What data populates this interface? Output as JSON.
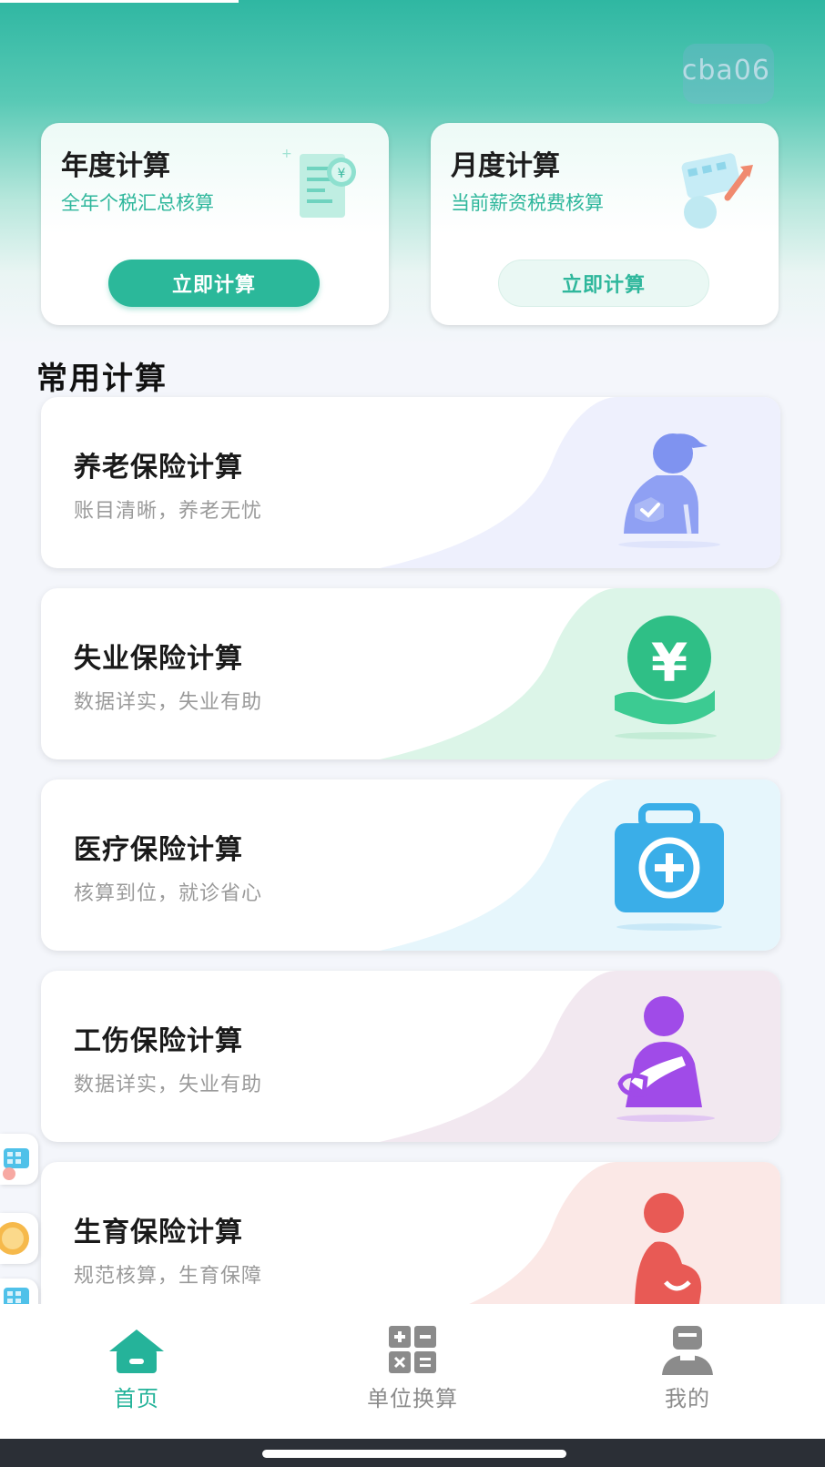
{
  "watermark": {
    "text": "cba06"
  },
  "top_cards": [
    {
      "title": "年度计算",
      "subtitle": "全年个税汇总核算",
      "button": "立即计算",
      "icon": "receipt-yen-icon"
    },
    {
      "title": "月度计算",
      "subtitle": "当前薪资税费核算",
      "button": "立即计算",
      "icon": "calendar-chart-icon"
    }
  ],
  "section": {
    "title": "常用计算"
  },
  "calc_items": [
    {
      "title": "养老保险计算",
      "subtitle": "账目清晰，养老无忧",
      "icon": "elderly-person-shield-icon",
      "accent": "#7f93f0"
    },
    {
      "title": "失业保险计算",
      "subtitle": "数据详实，失业有助",
      "icon": "hand-yen-coin-icon",
      "accent": "#2fbf86"
    },
    {
      "title": "医疗保险计算",
      "subtitle": "核算到位，就诊省心",
      "icon": "medical-kit-icon",
      "accent": "#3aaee8"
    },
    {
      "title": "工伤保险计算",
      "subtitle": "数据详实，失业有助",
      "icon": "injured-arm-sling-icon",
      "accent": "#a04be8"
    },
    {
      "title": "生育保险计算",
      "subtitle": "规范核算，生育保障",
      "icon": "pregnant-woman-icon",
      "accent": "#e85a55"
    }
  ],
  "nav": {
    "items": [
      {
        "label": "首页",
        "icon": "home-icon",
        "active": true
      },
      {
        "label": "单位换算",
        "icon": "calculator-icon",
        "active": false
      },
      {
        "label": "我的",
        "icon": "profile-icon",
        "active": false
      }
    ]
  },
  "colors": {
    "primary": "#2bb89a",
    "header_gradient_top": "#2fb7a2",
    "background": "#f4f6fb",
    "nav_inactive": "#8b8b8b"
  }
}
